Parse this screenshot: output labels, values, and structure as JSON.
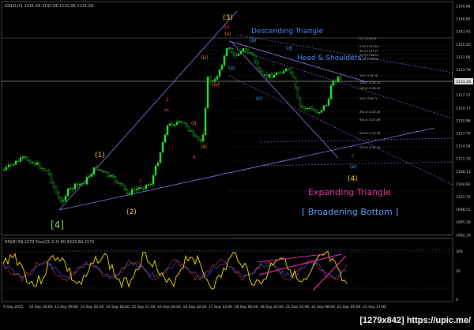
{
  "header": {
    "symbol_line": "GOLD,H1  1131.59 1132.06 1131.05 1131.26"
  },
  "indicator": {
    "label": "RSI(8) 59.1073  Dna(21,3,3) 60.5023 60.2172",
    "level_80": "80",
    "level_20": "20",
    "levels": [
      "100",
      "50",
      "0"
    ]
  },
  "price_axis": {
    "labels": [
      "1149.96",
      "1146.65",
      "1143.41",
      "1140.20",
      "1137.00",
      "1133.79",
      "1130.58",
      "1127.37",
      "1124.17",
      "1120.96",
      "1117.75",
      "1114.54",
      "1111.33",
      "1108.13",
      "1104.92",
      "1101.72",
      "1098.51",
      "1095.30",
      "1092.10"
    ],
    "current_price": "1131.26"
  },
  "time_axis": {
    "labels": [
      "9 Sep 2015",
      "10 Sep 16:00",
      "11 Sep 09:00",
      "14 Sep 02:00",
      "14 Sep 18:00",
      "15 Sep 11:00",
      "16 Sep 04:00",
      "16 Sep 20:00",
      "17 Sep 13:00",
      "18 Sep 06:00",
      "18 Sep 22:00",
      "21 Sep 15:00",
      "22 Sep 08:00",
      "23 Sep 01:00",
      "23 Sep 17:00"
    ]
  },
  "annotations": {
    "descending_triangle": "Descending Triangle",
    "head_shoulders": "Head & Shoulders",
    "expanding_triangle": "Expanding Triangle",
    "broadening_bottom": "[ Broadening Bottom ]"
  },
  "waves": {
    "w3": "(3)",
    "w1": "(1)",
    "w2": "(2)",
    "w4big": "[4]",
    "w4paren": "(4)",
    "wc": "c",
    "we": "(e)",
    "wa": "(a)",
    "wb": "(b)",
    "wc2": "(c)",
    "wd": "(d)",
    "w5x": "5x",
    "wv": "(v)",
    "wi": "(i)",
    "wii": "(ii)",
    "wiii": "(iii)",
    "wiv": "(iv)",
    "r2": "2",
    "r4": "4",
    "r1": "1",
    "rvx": "vx"
  },
  "fib_levels": [
    {
      "label": "0.0  1140.82"
    },
    {
      "label": "23.6 1137.63"
    },
    {
      "label": "38.2 1137.27"
    },
    {
      "label": "50.0 1136.80"
    },
    {
      "label": "61.8 1136.08"
    },
    {
      "label": "100  1133.76"
    },
    {
      "label": "138.2 1130.32"
    },
    {
      "label": "161.8 1128.50"
    },
    {
      "label": "200 1126.72"
    },
    {
      "label": "261.8 1124.40"
    },
    {
      "label": "361.8 1121.89"
    },
    {
      "label": "423.6 1119.36"
    },
    {
      "label": "523.6 1116.44"
    }
  ],
  "watermark": "[1279x842] https://upic.me/"
}
